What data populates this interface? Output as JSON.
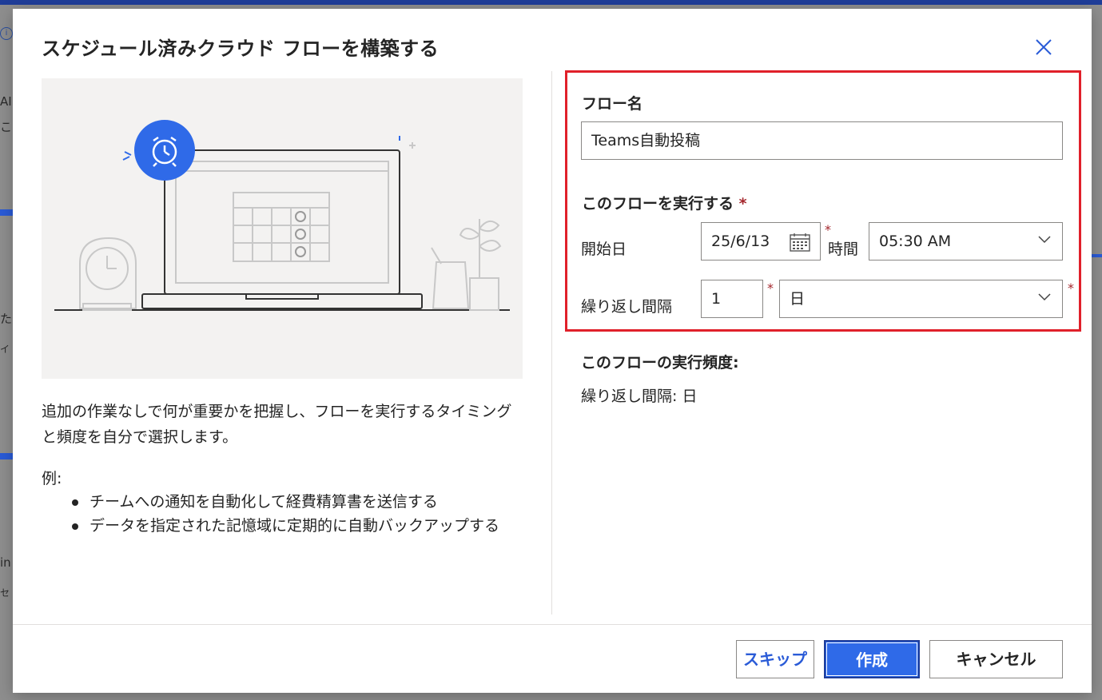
{
  "dialog": {
    "title": "スケジュール済みクラウド フローを構築する",
    "description": "追加の作業なしで何が重要かを把握し、フローを実行するタイミングと頻度を自分で選択します。",
    "example_label": "例:",
    "examples": [
      "チームへの通知を自動化して経費精算書を送信する",
      "データを指定された記憶域に定期的に自動バックアップする"
    ]
  },
  "form": {
    "flow_name_label": "フロー名",
    "flow_name_value": "Teams自動投稿",
    "run_section_label": "このフローを実行する",
    "required_mark": "*",
    "start_date_label": "開始日",
    "start_date_value": "25/6/13",
    "time_label": "時間",
    "time_value": "05:30 AM",
    "interval_label": "繰り返し間隔",
    "interval_value": "1",
    "interval_unit": "日"
  },
  "frequency": {
    "title": "このフローの実行頻度:",
    "value": "繰り返し間隔: 日"
  },
  "footer": {
    "skip_label": "スキップ",
    "create_label": "作成",
    "cancel_label": "キャンセル"
  },
  "background": {
    "fragments": [
      "AI",
      "こ",
      "た",
      "イ",
      "in",
      "セ"
    ]
  },
  "colors": {
    "accent": "#2f6ae8",
    "highlight_border": "#e0202a",
    "required": "#a4262c"
  }
}
